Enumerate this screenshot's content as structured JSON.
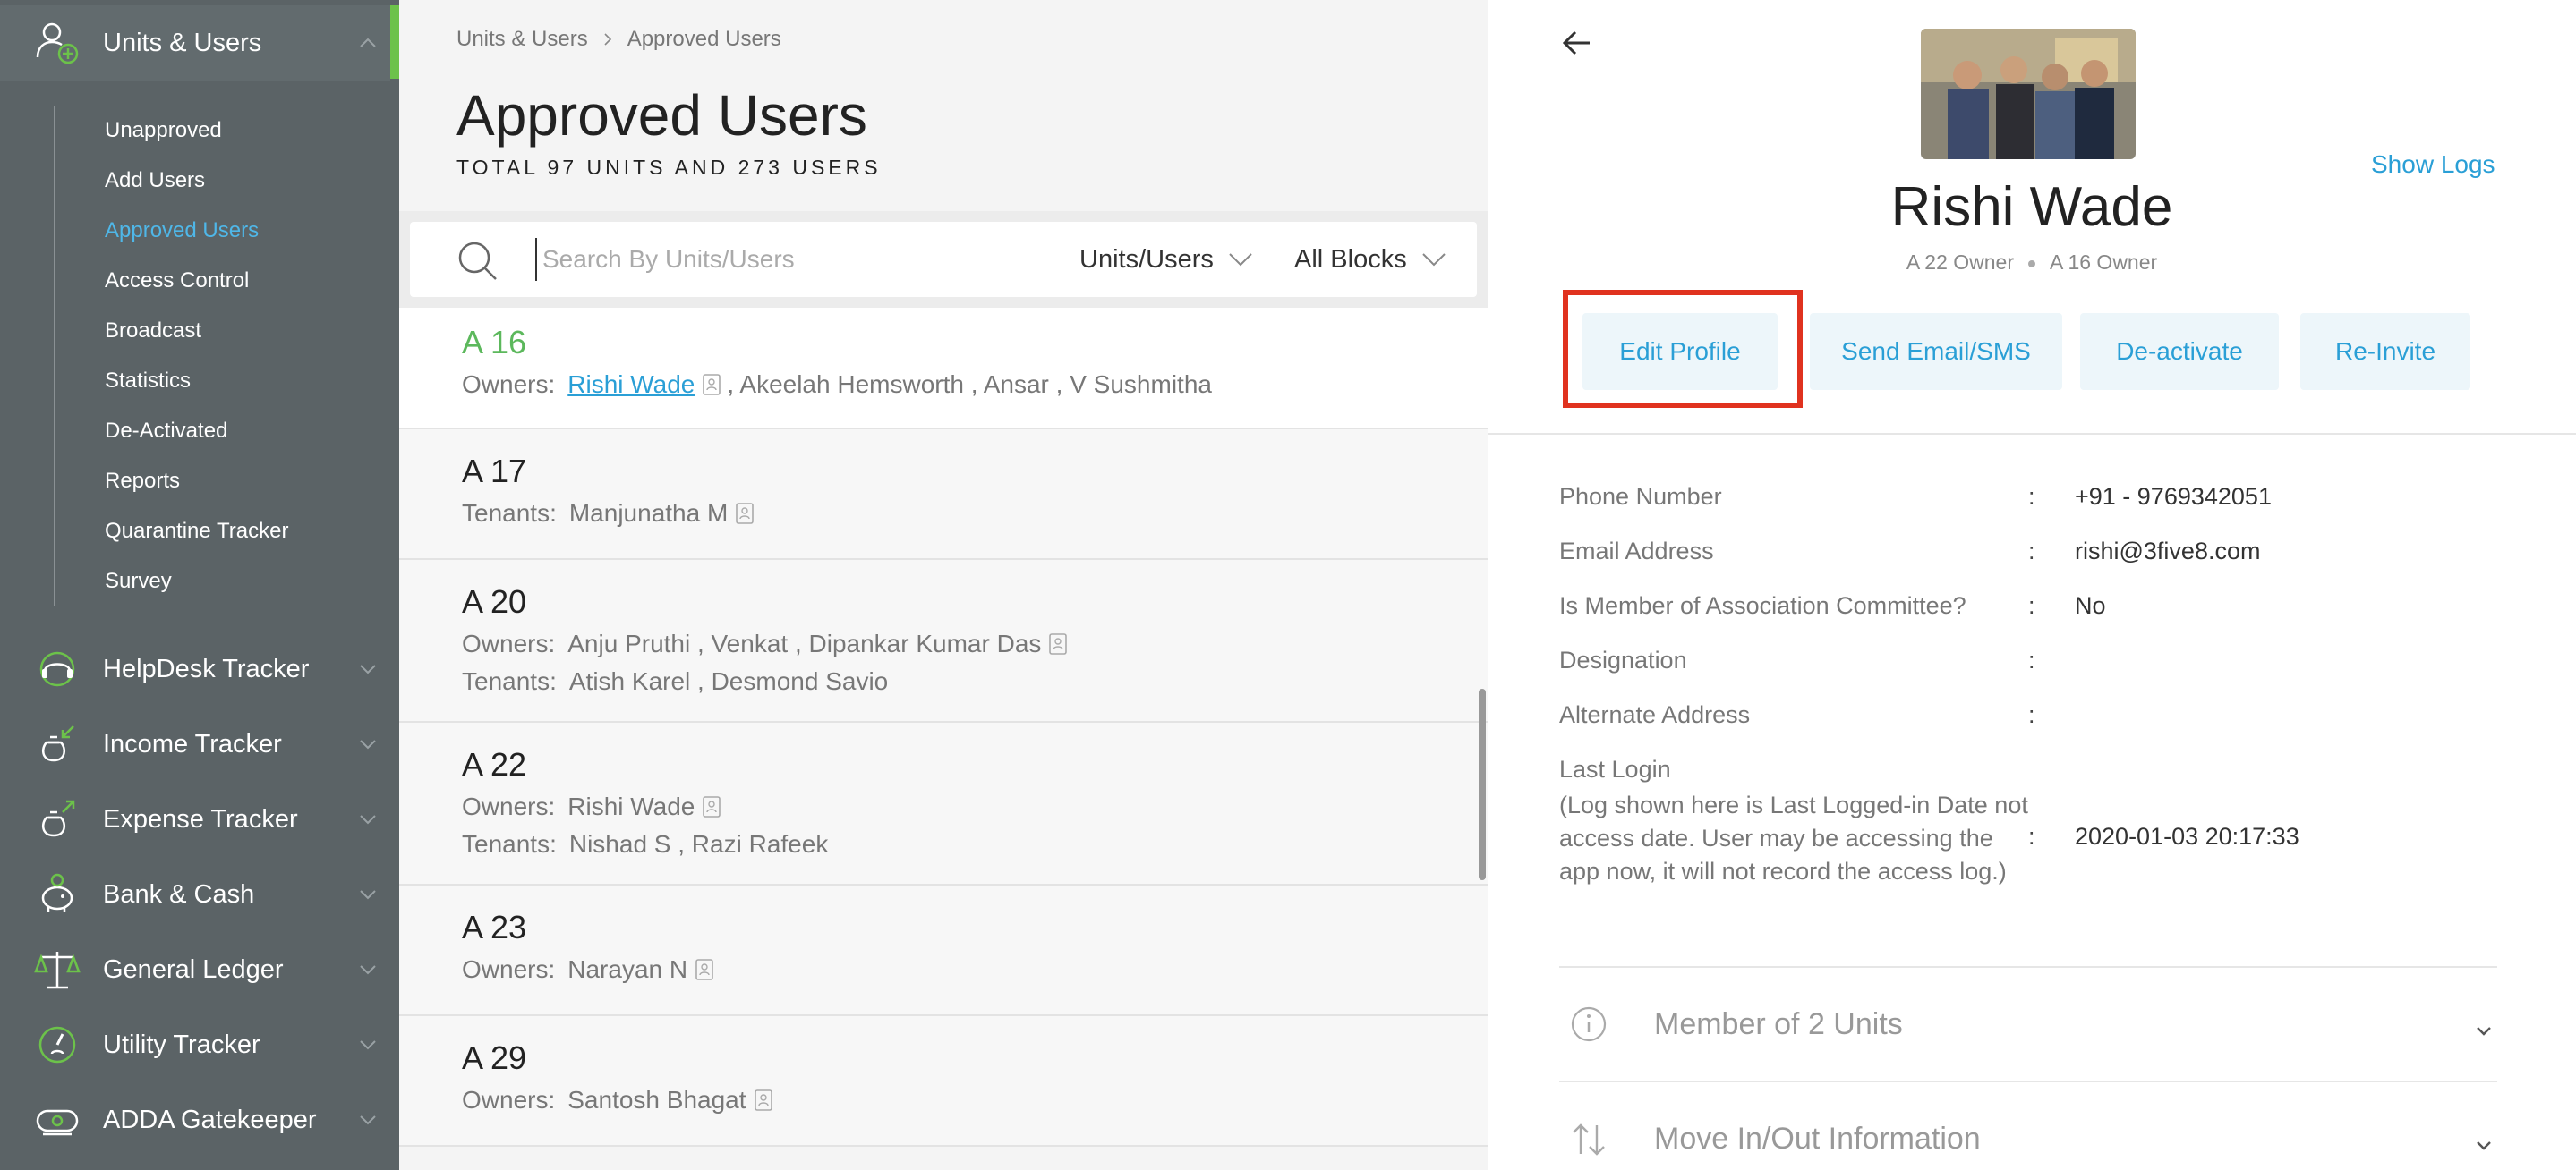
{
  "sidebar": {
    "main_items": [
      {
        "label": "Units & Users",
        "icon": "user-plus-icon"
      },
      {
        "label": "HelpDesk Tracker",
        "icon": "helpdesk-icon"
      },
      {
        "label": "Income Tracker",
        "icon": "income-icon"
      },
      {
        "label": "Expense Tracker",
        "icon": "expense-icon"
      },
      {
        "label": "Bank & Cash",
        "icon": "piggy-bank-icon"
      },
      {
        "label": "General Ledger",
        "icon": "scales-icon"
      },
      {
        "label": "Utility Tracker",
        "icon": "utility-gauge-icon"
      },
      {
        "label": "ADDA Gatekeeper",
        "icon": "gatekeeper-icon"
      }
    ],
    "sub_items": [
      {
        "label": "Unapproved"
      },
      {
        "label": "Add Users"
      },
      {
        "label": "Approved Users"
      },
      {
        "label": "Access Control"
      },
      {
        "label": "Broadcast"
      },
      {
        "label": "Statistics"
      },
      {
        "label": "De-Activated"
      },
      {
        "label": "Reports"
      },
      {
        "label": "Quarantine Tracker"
      },
      {
        "label": "Survey"
      }
    ],
    "active_sub_item": "Approved Users",
    "accent_color": "#6cc24a",
    "active_link_color": "#4fb7e8"
  },
  "middle": {
    "breadcrumb": [
      "Units & Users",
      "Approved Users"
    ],
    "title": "Approved Users",
    "subtitle": "TOTAL 97 UNITS AND 273 USERS",
    "search": {
      "placeholder": "Search By Units/Users",
      "value": ""
    },
    "filter_type": "Units/Users",
    "filter_block": "All Blocks",
    "units": [
      {
        "name": "A 16",
        "lines": [
          {
            "label": "Owners:",
            "names": [
              "Rishi Wade",
              ", Akeelah Hemsworth , Ansar , V Sushmitha"
            ]
          }
        ]
      },
      {
        "name": "A 17",
        "lines": [
          {
            "label": "Tenants:",
            "names": [
              "Manjunatha M"
            ]
          }
        ]
      },
      {
        "name": "A 20",
        "lines": [
          {
            "label": "Owners:",
            "names": [
              "Anju Pruthi , Venkat , Dipankar Kumar Das"
            ]
          },
          {
            "label": "Tenants:",
            "names": [
              "Atish Karel , Desmond Savio"
            ]
          }
        ]
      },
      {
        "name": "A 22",
        "lines": [
          {
            "label": "Owners:",
            "names": [
              "Rishi Wade"
            ]
          },
          {
            "label": "Tenants:",
            "names": [
              "Nishad S , Razi Rafeek"
            ]
          }
        ]
      },
      {
        "name": "A 23",
        "lines": [
          {
            "label": "Owners:",
            "names": [
              "Narayan N"
            ]
          }
        ]
      },
      {
        "name": "A 29",
        "lines": [
          {
            "label": "Owners:",
            "names": [
              "Santosh Bhagat"
            ]
          }
        ]
      }
    ]
  },
  "profile": {
    "show_logs": "Show Logs",
    "name": "Rishi Wade",
    "roles": [
      "A 22 Owner",
      "A 16 Owner"
    ],
    "actions": {
      "edit": "Edit Profile",
      "send": "Send Email/SMS",
      "deactivate": "De-activate",
      "reinvite": "Re-Invite"
    },
    "fields": [
      {
        "label": "Phone Number",
        "value": "+91 - 9769342051"
      },
      {
        "label": "Email Address",
        "value": "rishi@3five8.com"
      },
      {
        "label": "Is Member of Association Committee?",
        "value": "No"
      },
      {
        "label": "Designation",
        "value": ""
      },
      {
        "label": "Alternate Address",
        "value": ""
      }
    ],
    "last_login": {
      "label": "Last Login",
      "note": "(Log shown here is Last Logged-in Date not access date. User may be accessing the app now, it will not record the access log.)",
      "value": "2020-01-03 20:17:33"
    },
    "accordions": [
      {
        "label": "Member of 2 Units",
        "icon": "info-circle-icon"
      },
      {
        "label": "Move In/Out Information",
        "icon": "swap-arrows-icon"
      }
    ],
    "link_color": "#2a9fd6",
    "highlight_color": "#e0321f"
  }
}
